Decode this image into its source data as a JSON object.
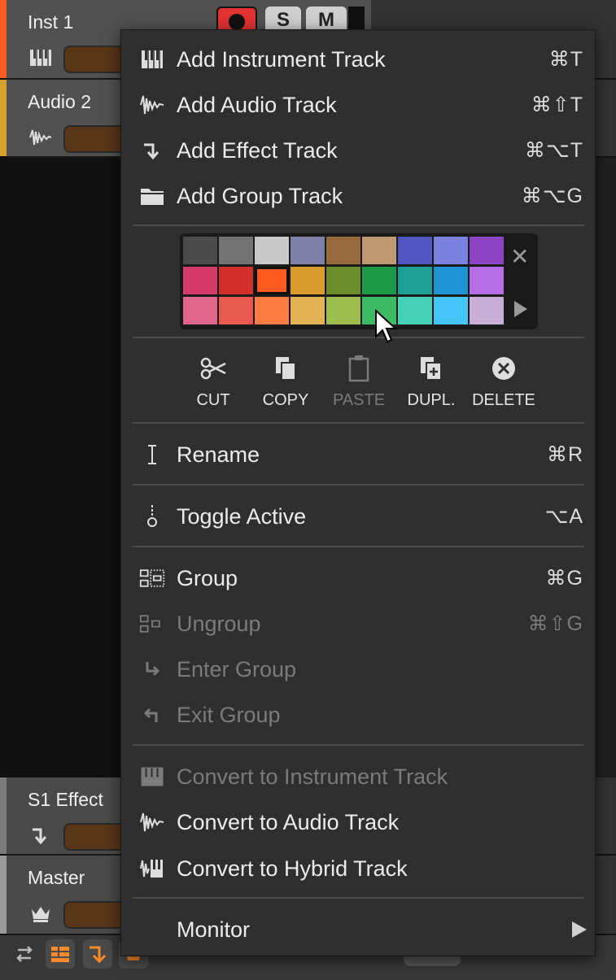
{
  "tracks": [
    {
      "name": "Inst 1",
      "color": "#ff5a1f",
      "icon": "piano-keys-icon"
    },
    {
      "name": "Audio 2",
      "color": "#d4a030",
      "icon": "waveform-icon"
    },
    {
      "name": "S1 Effect",
      "color": "#7a7a7a",
      "icon": "effect-arrow-icon"
    },
    {
      "name": "Master",
      "color": "#9a9a9a",
      "icon": "crown-icon"
    }
  ],
  "track_buttons": {
    "solo": "S",
    "mute": "M"
  },
  "menu": {
    "add": [
      {
        "label": "Add Instrument Track",
        "shortcut": "⌘T",
        "icon": "piano-keys-icon"
      },
      {
        "label": "Add Audio Track",
        "shortcut": "⌘⇧T",
        "icon": "waveform-icon"
      },
      {
        "label": "Add Effect Track",
        "shortcut": "⌘⌥T",
        "icon": "effect-arrow-icon"
      },
      {
        "label": "Add Group Track",
        "shortcut": "⌘⌥G",
        "icon": "folder-icon"
      }
    ],
    "palette": {
      "colors": [
        [
          "#4a4a4a",
          "#737373",
          "#c8c8c8",
          "#7e80a8",
          "#96693e",
          "#be9a72",
          "#5057c2",
          "#7b82de",
          "#8a44c4"
        ],
        [
          "#d43a6a",
          "#d03029",
          "#ff5a1f",
          "#d99b2c",
          "#6b8e2a",
          "#1c9a4a",
          "#20a094",
          "#1e94d2",
          "#b36ee6"
        ],
        [
          "#e0668e",
          "#e85a4e",
          "#ff7d44",
          "#e2b254",
          "#9dbd4e",
          "#3dba64",
          "#45d0b8",
          "#44c4f8",
          "#c9aed8"
        ]
      ],
      "selected": "#ff5a1f"
    },
    "actions": [
      {
        "label": "CUT",
        "icon": "scissors-icon",
        "enabled": true
      },
      {
        "label": "COPY",
        "icon": "copy-icon",
        "enabled": true
      },
      {
        "label": "PASTE",
        "icon": "paste-icon",
        "enabled": false
      },
      {
        "label": "DUPL.",
        "icon": "duplicate-icon",
        "enabled": true
      },
      {
        "label": "DELETE",
        "icon": "delete-icon",
        "enabled": true
      }
    ],
    "rename": {
      "label": "Rename",
      "shortcut": "⌘R"
    },
    "toggle_active": {
      "label": "Toggle Active",
      "shortcut": "⌥A"
    },
    "group": [
      {
        "label": "Group",
        "shortcut": "⌘G",
        "enabled": true
      },
      {
        "label": "Ungroup",
        "shortcut": "⌘⇧G",
        "enabled": false
      },
      {
        "label": "Enter Group",
        "shortcut": "",
        "enabled": false
      },
      {
        "label": "Exit Group",
        "shortcut": "",
        "enabled": false
      }
    ],
    "convert": [
      {
        "label": "Convert to Instrument Track",
        "enabled": false
      },
      {
        "label": "Convert to Audio Track",
        "enabled": true
      },
      {
        "label": "Convert to Hybrid Track",
        "enabled": true
      }
    ],
    "monitor": {
      "label": "Monitor"
    }
  }
}
